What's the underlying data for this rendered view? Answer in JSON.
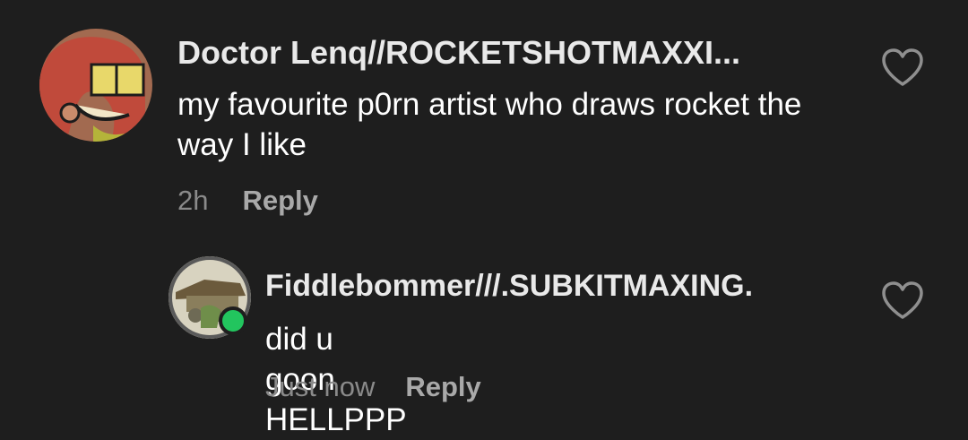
{
  "comments": [
    {
      "username": "Doctor Lenq//ROCKETSHOTMAXXI...",
      "text": "my favourite p0rn artist who draws rocket the way I like",
      "time": "2h",
      "reply_label": "Reply",
      "like_icon": "heart-outline-icon"
    },
    {
      "username": "Fiddlebommer///.SUBKITMAXING.",
      "text": "did u goon HELLPPP",
      "time": "Just now",
      "reply_label": "Reply",
      "like_icon": "heart-outline-icon",
      "online": true
    }
  ],
  "colors": {
    "background": "#1e1e1e",
    "username": "#e9e9e9",
    "text": "#ffffff",
    "timestamp": "#8a8a8a",
    "reply": "#a9a9a9",
    "online_dot": "#22c55e"
  }
}
